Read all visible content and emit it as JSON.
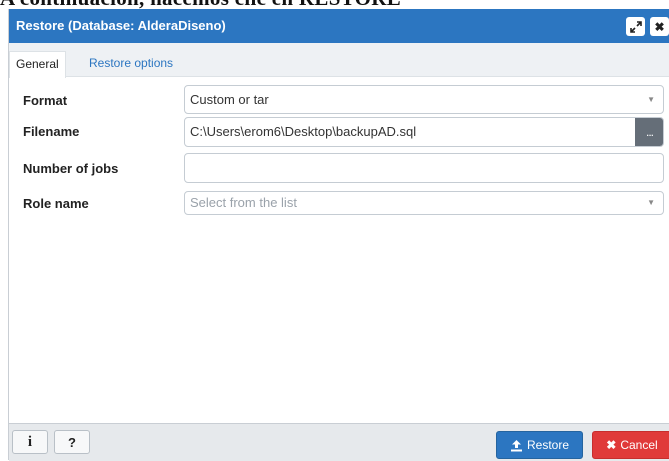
{
  "background_text": "A continuación, hacemos clic en RESTORE",
  "dialog": {
    "title": "Restore (Database: AlderaDiseno)",
    "maximize_icon": "expand-arrows-icon",
    "close_icon": "close-x-icon"
  },
  "tabs": [
    {
      "label": "General",
      "active": true
    },
    {
      "label": "Restore options",
      "active": false
    }
  ],
  "form": {
    "format": {
      "label": "Format",
      "value": "Custom or tar"
    },
    "filename": {
      "label": "Filename",
      "value": "C:\\Users\\erom6\\Desktop\\backupAD.sql",
      "browse_label": "..."
    },
    "jobs": {
      "label": "Number of jobs",
      "value": ""
    },
    "role": {
      "label": "Role name",
      "placeholder": "Select from the list"
    }
  },
  "footer": {
    "info_label": "i",
    "help_label": "?",
    "restore_label": "Restore",
    "cancel_label": "Cancel"
  },
  "colors": {
    "titlebar": "#2c76c1",
    "restore_button": "#2c76c1",
    "cancel_button": "#e03a3a",
    "browse_button": "#656e78"
  }
}
